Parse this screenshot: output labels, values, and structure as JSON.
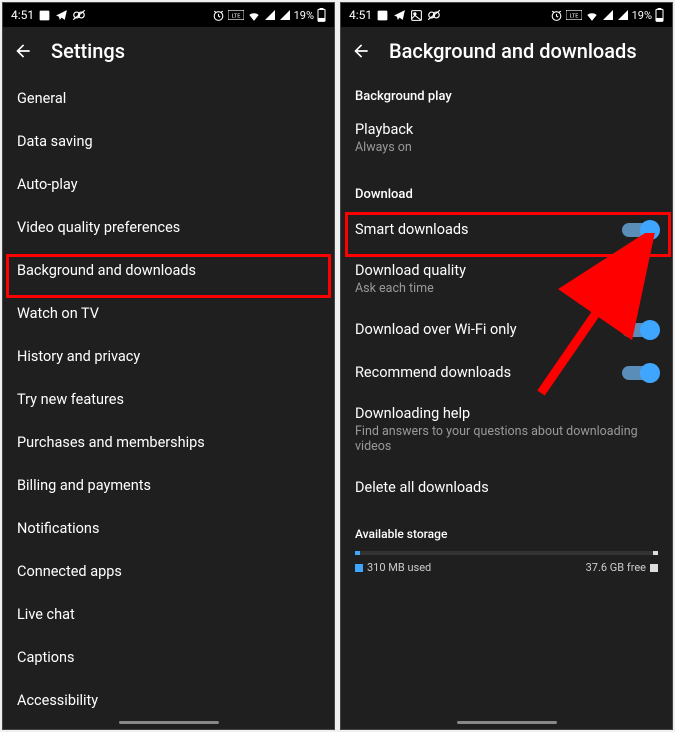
{
  "status": {
    "time": "4:51",
    "battery_pct": "19%"
  },
  "left": {
    "title": "Settings",
    "items": [
      "General",
      "Data saving",
      "Auto-play",
      "Video quality preferences",
      "Background and downloads",
      "Watch on TV",
      "History and privacy",
      "Try new features",
      "Purchases and memberships",
      "Billing and payments",
      "Notifications",
      "Connected apps",
      "Live chat",
      "Captions",
      "Accessibility"
    ]
  },
  "right": {
    "title": "Background and downloads",
    "section_bg": "Background play",
    "playback_label": "Playback",
    "playback_sub": "Always on",
    "section_dl": "Download",
    "smart_dl": "Smart downloads",
    "dl_quality": "Download quality",
    "dl_quality_sub": "Ask each time",
    "dl_wifi": "Download over Wi-Fi only",
    "rec_dl": "Recommend downloads",
    "dl_help": "Downloading help",
    "dl_help_sub": "Find answers to your questions about downloading videos",
    "del_all": "Delete all downloads",
    "storage_label": "Available storage",
    "storage_used": "310 MB used",
    "storage_free": "37.6 GB free"
  }
}
